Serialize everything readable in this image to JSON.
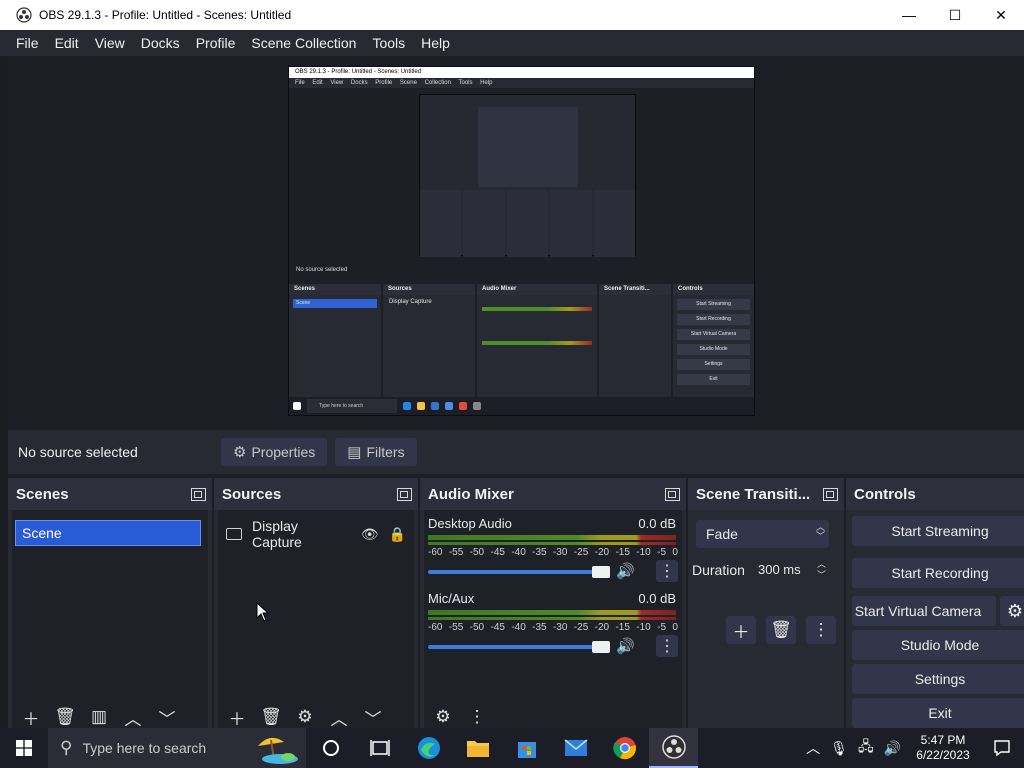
{
  "window": {
    "title": "OBS 29.1.3 - Profile: Untitled - Scenes: Untitled",
    "minimize": "—",
    "maximize": "☐",
    "close": "✕"
  },
  "menu": [
    "File",
    "Edit",
    "View",
    "Docks",
    "Profile",
    "Scene Collection",
    "Tools",
    "Help"
  ],
  "preview": {
    "title": "OBS 29.1.3 - Profile: Untitled - Scenes: Untitled",
    "menu": "File Edit View Docks Profile Scene Collection Tools Help",
    "status": "No source selected",
    "scenes": "Scenes",
    "scene_item": "Scene",
    "sources": "Sources",
    "source_item": "Display Capture",
    "audio": "Audio Mixer",
    "transitions": "Scene Transiti...",
    "controls": "Controls",
    "ctrl_buttons": [
      "Start Streaming",
      "Start Recording",
      "Start Virtual Camera",
      "Studio Mode",
      "Settings",
      "Exit"
    ],
    "search": "Type here to search"
  },
  "status_bar": {
    "no_source": "No source selected",
    "properties": "Properties",
    "filters": "Filters"
  },
  "scenes": {
    "title": "Scenes",
    "items": [
      "Scene"
    ]
  },
  "sources": {
    "title": "Sources",
    "items": [
      "Display Capture"
    ]
  },
  "audio_mixer": {
    "title": "Audio Mixer",
    "scale": [
      "-60",
      "-55",
      "-50",
      "-45",
      "-40",
      "-35",
      "-30",
      "-25",
      "-20",
      "-15",
      "-10",
      "-5",
      "0"
    ],
    "channels": [
      {
        "name": "Desktop Audio",
        "db": "0.0 dB",
        "volume": 1.0
      },
      {
        "name": "Mic/Aux",
        "db": "0.0 dB",
        "volume": 1.0
      }
    ]
  },
  "transitions": {
    "title": "Scene Transiti...",
    "selected": "Fade",
    "duration_label": "Duration",
    "duration_value": "300 ms"
  },
  "controls": {
    "title": "Controls",
    "buttons": [
      "Start Streaming",
      "Start Recording",
      "Start Virtual Camera",
      "Studio Mode",
      "Settings",
      "Exit"
    ]
  },
  "taskbar": {
    "search_placeholder": "Type here to search",
    "time": "5:47 PM",
    "date": "6/22/2023"
  },
  "colors": {
    "accent": "#2a5bd6",
    "panel": "#272a33",
    "background": "#1c1d23"
  }
}
